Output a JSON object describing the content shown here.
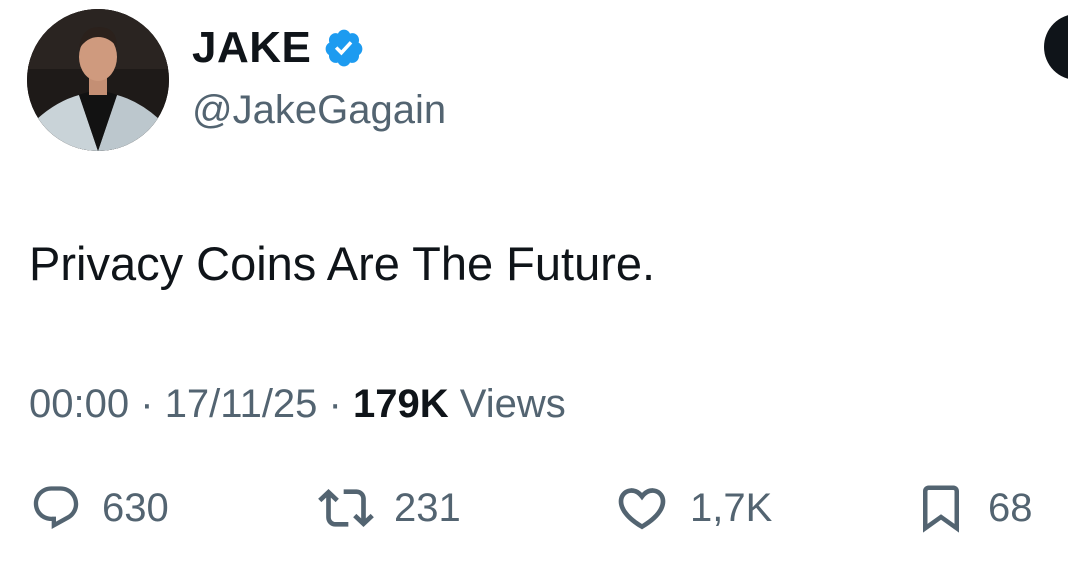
{
  "author": {
    "display_name": "JAKE",
    "handle": "@JakeGagain",
    "verified": true,
    "verified_color": "#1d9bf0",
    "avatar_icon": "profile-photo"
  },
  "tweet": {
    "text": "Privacy Coins Are The Future."
  },
  "meta": {
    "time": "00:00",
    "separator": "·",
    "date": "17/11/25",
    "views_count": "179K",
    "views_label": "Views"
  },
  "actions": {
    "replies": {
      "icon": "reply-icon",
      "count": "630"
    },
    "retweets": {
      "icon": "retweet-icon",
      "count": "231"
    },
    "likes": {
      "icon": "heart-icon",
      "count": "1,7K"
    },
    "bookmarks": {
      "icon": "bookmark-icon",
      "count": "68"
    }
  },
  "colors": {
    "text_primary": "#0f1419",
    "text_secondary": "#536471",
    "background": "#ffffff"
  }
}
